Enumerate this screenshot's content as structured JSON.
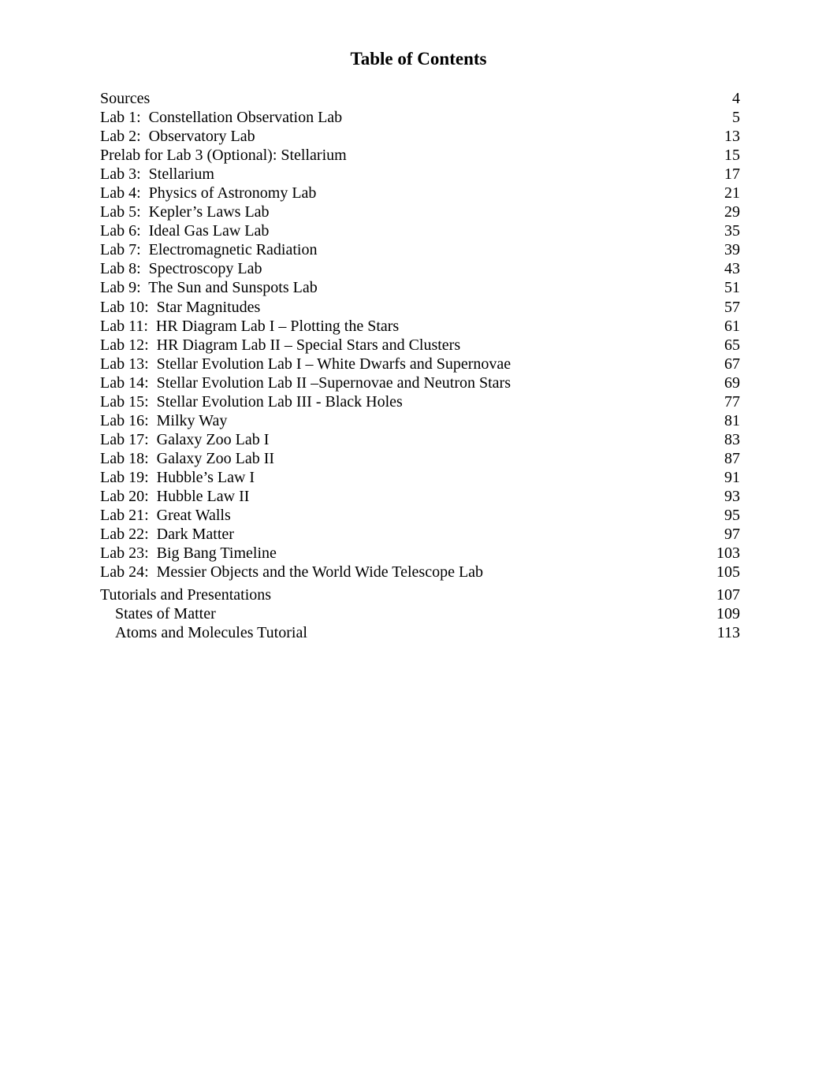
{
  "document": {
    "title": "Table of Contents",
    "entries": [
      {
        "label": "Sources",
        "page": "4"
      },
      {
        "label": "Lab 1:  Constellation Observation Lab",
        "page": "5"
      },
      {
        "label": "Lab 2:  Observatory Lab",
        "page": "13"
      },
      {
        "label": "Prelab for Lab 3 (Optional): Stellarium",
        "page": "15"
      },
      {
        "label": "Lab 3:  Stellarium",
        "page": "17"
      },
      {
        "label": "Lab 4:  Physics of Astronomy Lab",
        "page": "21"
      },
      {
        "label": "Lab 5:  Kepler’s Laws Lab",
        "page": "29"
      },
      {
        "label": "Lab 6:  Ideal Gas Law Lab",
        "page": "35"
      },
      {
        "label": "Lab 7:  Electromagnetic Radiation",
        "page": "39"
      },
      {
        "label": "Lab 8:  Spectroscopy Lab",
        "page": "43"
      },
      {
        "label": "Lab 9:  The Sun and Sunspots Lab",
        "page": "51"
      },
      {
        "label": "Lab 10:  Star Magnitudes",
        "page": "57"
      },
      {
        "label": "Lab 11:  HR Diagram Lab I – Plotting the Stars",
        "page": "61"
      },
      {
        "label": "Lab 12:  HR Diagram Lab II – Special Stars and Clusters",
        "page": "65"
      },
      {
        "label": "Lab 13:  Stellar Evolution Lab I – White Dwarfs and Supernovae",
        "page": "67"
      },
      {
        "label": "Lab 14:  Stellar Evolution Lab II –Supernovae and Neutron Stars",
        "page": "69"
      },
      {
        "label": "Lab 15:  Stellar Evolution Lab III - Black Holes",
        "page": "77"
      },
      {
        "label": "Lab 16:  Milky Way",
        "page": "81"
      },
      {
        "label": "Lab 17:  Galaxy Zoo Lab I",
        "page": "83"
      },
      {
        "label": "Lab 18:  Galaxy Zoo Lab II",
        "page": "87"
      },
      {
        "label": "Lab 19:  Hubble’s Law I",
        "page": "91"
      },
      {
        "label": "Lab 20:  Hubble Law II",
        "page": "93"
      },
      {
        "label": "Lab 21:  Great Walls",
        "page": "95"
      },
      {
        "label": "Lab 22:  Dark Matter",
        "page": "97"
      },
      {
        "label": "Lab 23:  Big Bang Timeline",
        "page": "103"
      },
      {
        "label": "Lab 24:  Messier Objects and the World Wide Telescope Lab",
        "page": "105"
      },
      {
        "label": "Tutorials and Presentations",
        "page": "107"
      },
      {
        "label": "States of Matter",
        "page": "109"
      },
      {
        "label": "Atoms and Molecules Tutorial",
        "page": "113"
      }
    ]
  }
}
